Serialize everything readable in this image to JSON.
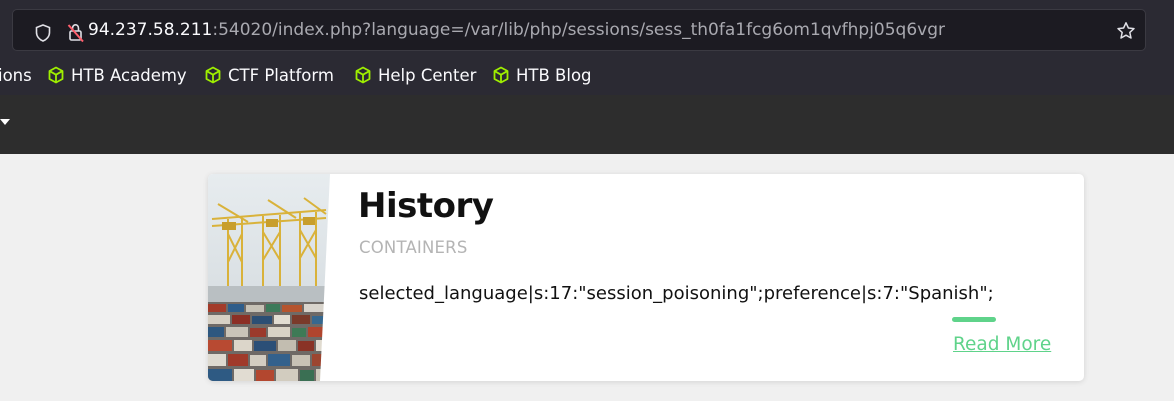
{
  "browser": {
    "url_host": "94.237.58.211",
    "url_rest": ":54020/index.php?language=/var/lib/php/sessions/sess_th0fa1fcg6om1qvfhpj05q6vgr",
    "bookmarks": [
      {
        "label": "ions",
        "icon": "none"
      },
      {
        "label": "HTB Academy",
        "icon": "hexagon-cube-icon"
      },
      {
        "label": "CTF Platform",
        "icon": "hexagon-cube-icon"
      },
      {
        "label": "Help Center",
        "icon": "hexagon-cube-icon"
      },
      {
        "label": "HTB Blog",
        "icon": "hexagon-cube-icon"
      }
    ]
  },
  "card": {
    "title": "History",
    "category": "CONTAINERS",
    "body": "selected_language|s:17:\"session_poisoning\";preference|s:7:\"Spanish\";",
    "read_more": "Read More"
  },
  "colors": {
    "accent": "#5fd38a",
    "toolbar_bg": "#2b2a33",
    "nav_bg": "#2d2d2d",
    "page_bg": "#f0f0f0",
    "bookmark_icon": "#9fef00"
  }
}
